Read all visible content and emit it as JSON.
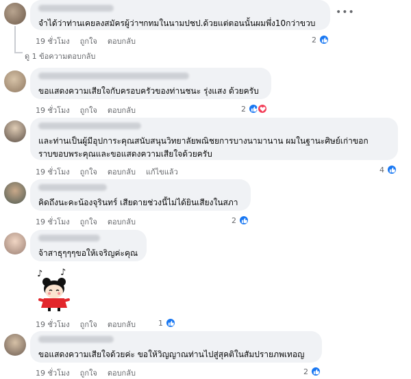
{
  "comments": [
    {
      "text": "จำได้ว่าท่านเคยลงสมัครผู้ว่าฯกทมในนามปชป.ด้วยแต่ตอนนั้นผมพึ่ง10กว่าขวบ",
      "time": "19 ชั่วโมง",
      "like": "ถูกใจ",
      "reply": "ตอบกลับ",
      "reaction_count": "2"
    },
    {
      "text": "ขอแสดงความเสียใจกับครอบครัวของท่านชนะ รุ่งแสง ด้วยครับ",
      "time": "19 ชั่วโมง",
      "like": "ถูกใจ",
      "reply": "ตอบกลับ",
      "reaction_count": "2"
    },
    {
      "text_lines": [
        "และท่านเป็นผู้มีอุปการะคุณสนับสนุนวิทยาลัยพณิชยการบางนามานาน ผมในฐานะศิษย์เก่าขอกราบขอบพระคุณและขอแสดงความเสียใจด้วยครับ"
      ],
      "line1": "และท่านเป็นผู้มีอุปการะคุณสนับสนุนวิทยาลัยพณิชยการบางนามานาน ผมในฐานะศิษย์เก่าขอก",
      "line2": "ราบขอบพระคุณและขอแสดงความเสียใจด้วยครับ",
      "time": "19 ชั่วโมง",
      "like": "ถูกใจ",
      "reply": "ตอบกลับ",
      "edited": "แก้ไขแล้ว",
      "reaction_count": "4"
    },
    {
      "text": "คิดถึงนะคะน้องจุรินทร์ เสียดายช่วงนี้ไม่ได้ยินเสียงในสภา",
      "time": "19 ชั่วโมง",
      "like": "ถูกใจ",
      "reply": "ตอบกลับ",
      "reaction_count": "2"
    },
    {
      "text": "จ้าสาธุๆๆๆขอให้เจริญค่ะคุณ",
      "time": "19 ชั่วโมง",
      "like": "ถูกใจ",
      "reply": "ตอบกลับ",
      "reaction_count": "1"
    },
    {
      "text": "ขอแสดงความเสียใจด้วยค่ะ ขอให้วิญญาณท่านไปสู่สุคติในสัมปรายภพเทอญ",
      "time": "19 ชั่วโมง",
      "like": "ถูกใจ",
      "reply": "ตอบกลับ",
      "reaction_count": "2"
    }
  ],
  "replies_link": "ดู 1 ข้อความตอบกลับ",
  "more_icon": "•••",
  "colors": {
    "like_blue": "#1877f2",
    "love_red": "#f33e58",
    "bubble": "#f0f2f5",
    "meta_gray": "#65676b"
  }
}
